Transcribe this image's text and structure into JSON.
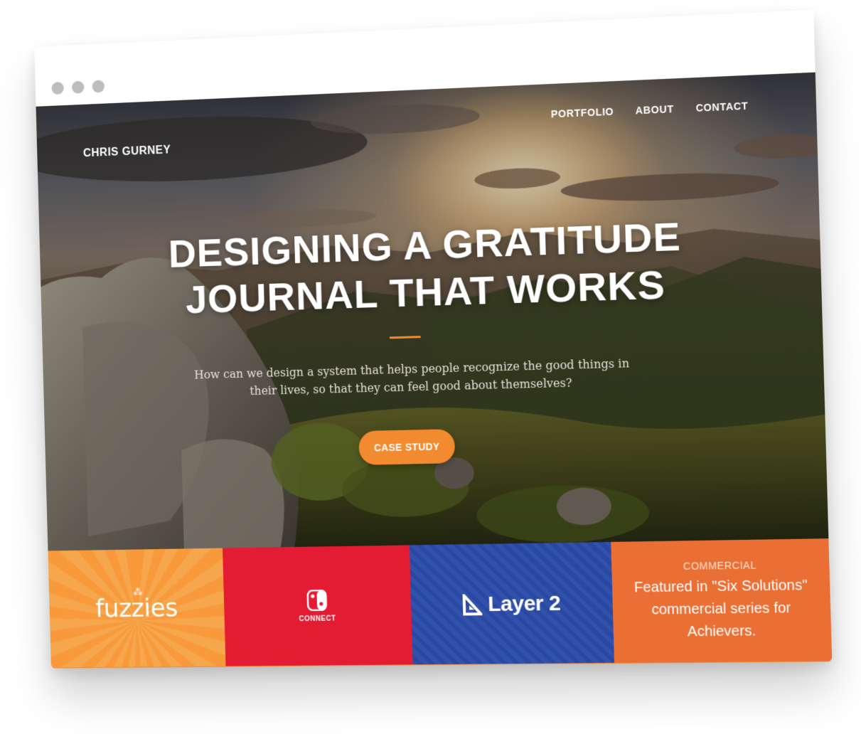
{
  "browser": {
    "window_controls": [
      "dot",
      "dot",
      "dot"
    ]
  },
  "nav": {
    "logo": "CHRIS GURNEY",
    "links": [
      "PORTFOLIO",
      "ABOUT",
      "CONTACT"
    ]
  },
  "hero": {
    "headline_line1": "DESIGNING A GRATITUDE",
    "headline_line2": "JOURNAL THAT WORKS",
    "subtitle": "How can we design a system that helps people recognize the good things in their lives, so that they can feel good about themselves?",
    "cta_label": "CASE STUDY"
  },
  "tiles": {
    "fuzzies": {
      "label": "fuzzies"
    },
    "nintendo": {
      "label": "CONNECT"
    },
    "layer2": {
      "label": "Layer 2"
    },
    "commercial": {
      "tag": "COMMERCIAL",
      "text": "Featured in \"Six Solutions\" commercial series for Achievers."
    }
  },
  "colors": {
    "accent": "#f28a30",
    "nintendo_red": "#e31b33",
    "layer2_blue": "#2a4aa8",
    "commercial_orange": "#ea6f35"
  }
}
